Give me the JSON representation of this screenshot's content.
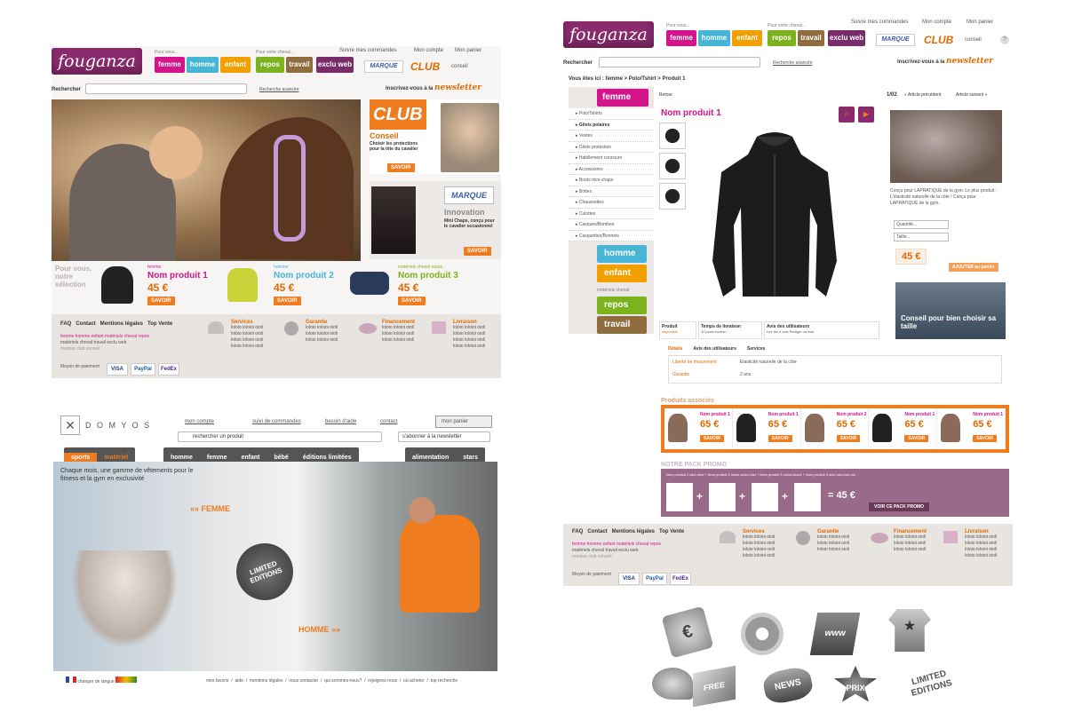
{
  "brand": {
    "logo": "fouganza",
    "club": "CLUB",
    "marque": "MARQUE",
    "conseil": "conseil",
    "news_word": "newsletter",
    "news_pre": "Inscrivez-vous à la"
  },
  "caps": {
    "pour_vous": "Pour vous...",
    "pour_cheval": "Pour votre cheval..."
  },
  "nav": {
    "femme": "femme",
    "homme": "homme",
    "enfant": "enfant",
    "repos": "repos",
    "travail": "travail",
    "exclu": "exclu web"
  },
  "toplinks": {
    "commandes": "Suivre mes commandes",
    "compte": "Mon compte",
    "panier": "Mon panier"
  },
  "search": {
    "label": "Rechercher",
    "advanced": "Recherche avancée"
  },
  "home": {
    "club_title": "CLUB",
    "club_sub": "Conseil",
    "club_text": "Choisir les protections pour la tête du cavalier",
    "savoir": "SAVOIR",
    "marque_title": "Innovation",
    "marque_text": "Mini Chaps, conçu pour le cavalier occasionnel",
    "pour_vous": "Pour vous, notre sélection",
    "products": [
      {
        "cat": "femme",
        "name": "Nom produit 1",
        "price": "45 €",
        "color": "#d4148b"
      },
      {
        "cat": "homme",
        "name": "Nom produit 2",
        "price": "45 €",
        "color": "#46b5d6"
      },
      {
        "cat": "matériels cheval repos",
        "name": "Nom produit 3",
        "price": "45 €",
        "color": "#7bb21d"
      }
    ]
  },
  "footer": {
    "links": "FAQ   Contact   Mentions légales   Top Vente",
    "cats1": "femme  homme  enfant  matériels cheval repos",
    "cats2": "matériels cheval travail    exclu web",
    "cats3": "marque   club   conseil",
    "pay": "Moyen de paiement",
    "cols": [
      {
        "t": "Services"
      },
      {
        "t": "Garantie"
      },
      {
        "t": "Financement"
      },
      {
        "t": "Livraison"
      }
    ],
    "lorem": "loloio loloioi oioli",
    "visa": "VISA",
    "paypal": "PayPal",
    "fedex": "FedEx"
  },
  "product": {
    "breadcrumb": "Vous êtes ici : femme > Polo/Tshirt > Produit 1",
    "retour": "Retour",
    "pager": "1/02",
    "prev": "« Article précédent",
    "next": "Article suivant »",
    "title": "Nom produit 1",
    "side_items": [
      "Polo/Tshirts",
      "Gilets polaires",
      "Vestes",
      "Gilets protection",
      "Habillement concours",
      "Accessoires",
      "Boots mini-chaps",
      "Bottes",
      "Chaussettes",
      "Culottes",
      "Casques/Bombes",
      "Casquettes/Bonnets"
    ],
    "side_tabs": [
      "homme",
      "enfant"
    ],
    "side_cap": "matériels cheval",
    "side_tabs2": [
      "repos",
      "travail"
    ],
    "desc": "Conçu pour LAPRATIQUE de la gym. Le plus produit : L'élasticité naturelle de la côte ! Conçu pour LAPRATIQUE de la gym.",
    "qty": "Quantité...",
    "size": "Taille...",
    "price": "45 €",
    "add": "AJOUTER au panier",
    "conseil": "Conseil pour bien choisir sa taille",
    "info": [
      {
        "t": "Produit",
        "s": "disponible"
      },
      {
        "t": "Temps de livraison",
        "s": "10 jours environ"
      },
      {
        "t": "Avis des utilisateurs",
        "s": "Lire les 2 avis   Rédiger un avis"
      }
    ],
    "tabs": [
      "Détails",
      "Avis des utilisateurs",
      "Services"
    ],
    "details": [
      {
        "k": "Liberté de mouvement",
        "v": "Elasticité naturelle de la côte"
      },
      {
        "k": "Garantie",
        "v": "2 ans"
      }
    ],
    "assoc_title": "Produits associés",
    "assoc": [
      {
        "n": "Nom produit 1",
        "p": "65 €"
      },
      {
        "n": "Nom produit 1",
        "p": "65 €"
      },
      {
        "n": "Nom produit 2",
        "p": "65 €"
      },
      {
        "n": "Nom produit 1",
        "p": "65 €"
      },
      {
        "n": "Nom produit 1",
        "p": "65 €"
      }
    ],
    "pack_title": "NOTRE PACK PROMO",
    "pack_text": "Nom produit 1 loloi oioo + Nom produit 2 loloio oioloi ioloi + Nom produit 3 oioloi ioloioi + Nom produit 4 ioloi ioloi ioloi oio",
    "pack_price": "= 45 €",
    "pack_btn": "VOIR CE PACK PROMO"
  },
  "domyos": {
    "logo": "D O M Y O S",
    "links": [
      "mon compte",
      "suivi de commandes",
      "besoin d'aide",
      "contact",
      "mon panier"
    ],
    "search": "rechercher un produit",
    "news": "s'abonner à la newsletter",
    "tabs": [
      "sports",
      "matériel"
    ],
    "nav": [
      "homme",
      "femme",
      "enfant",
      "bébé",
      "éditions limitées"
    ],
    "nav2": [
      "alimentation",
      "stars"
    ],
    "headline": "Chaque mois, une gamme de vêtements pour le fitness et la gym en exclusivité",
    "femme": "«« FEMME",
    "homme": "HOMME »»",
    "ltd": "LIMITED EDITIONS",
    "lang": "changer de langue",
    "footer": "mes favoris  /  aide  /  mentions légales  /  nous contacter  /  qui sommes-nous?  /  rejoignez-nous  /  où acheter  /  top recherche"
  },
  "icons": [
    {
      "n": "euro-tag-icon",
      "t": "€"
    },
    {
      "n": "gears-icon",
      "t": ""
    },
    {
      "n": "www-laptop-icon",
      "t": "www"
    },
    {
      "n": "tshirt-star-icon",
      "t": "★"
    },
    {
      "n": "cap-icon",
      "t": ""
    },
    {
      "n": "free-box-icon",
      "t": "FREE"
    },
    {
      "n": "news-icon",
      "t": "NEWS"
    },
    {
      "n": "prix-icon",
      "t": "PRIX"
    },
    {
      "n": "limited-editions-icon",
      "t": "LIMITED EDITIONS"
    }
  ]
}
